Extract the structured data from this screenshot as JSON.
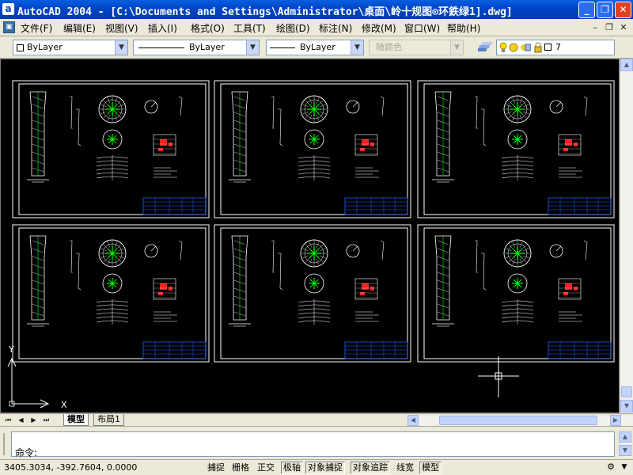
{
  "window": {
    "title": "AutoCAD 2004 - [C:\\Documents and Settings\\Administrator\\桌面\\岭十规图⊙环鉄绿1].dwg]",
    "app_icon_letter": "a",
    "minimize_glyph": "_",
    "restore_glyph": "❐",
    "close_glyph": "✕"
  },
  "menu": {
    "items": [
      "文件(F)",
      "编辑(E)",
      "视图(V)",
      "插入(I)",
      "格式(O)",
      "工具(T)",
      "绘图(D)",
      "标注(N)",
      "修改(M)",
      "窗口(W)",
      "帮助(H)"
    ],
    "doc_minimize_glyph": "–",
    "doc_restore_glyph": "❐",
    "doc_close_glyph": "✕"
  },
  "properties": {
    "color": "ByLayer",
    "linetype": "ByLayer",
    "lineweight": "ByLayer",
    "plotstyle": "随颜色",
    "layer_current": "7"
  },
  "drawing": {
    "sheet_count": 6,
    "ucs_x_label": "X",
    "ucs_y_label": "Y",
    "background": "#000000",
    "frame_color": "#ffffff",
    "accent_green": "#00ff00",
    "accent_blue": "#2060ff",
    "accent_red": "#ff2020"
  },
  "tabs": {
    "nav": [
      "⏮",
      "◀",
      "▶",
      "⏭"
    ],
    "model": "模型",
    "layout1": "布局1"
  },
  "command": {
    "prompt": "命令:"
  },
  "status": {
    "coordinates": "3405.3034, -392.7604, 0.0000",
    "toggles": [
      {
        "label": "捕捉",
        "on": false
      },
      {
        "label": "栅格",
        "on": false
      },
      {
        "label": "正交",
        "on": false
      },
      {
        "label": "极轴",
        "on": true
      },
      {
        "label": "对象捕捉",
        "on": true
      },
      {
        "label": "对象追踪",
        "on": true
      },
      {
        "label": "线宽",
        "on": false
      },
      {
        "label": "模型",
        "on": true
      }
    ]
  }
}
